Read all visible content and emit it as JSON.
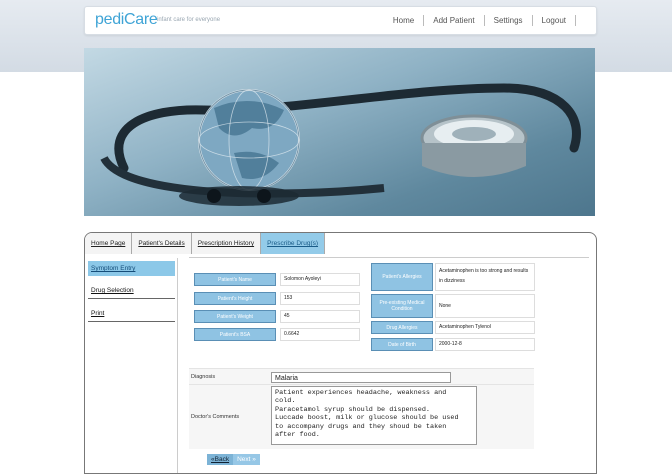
{
  "app": {
    "name": "pediCare",
    "tagline": "infant care for everyone"
  },
  "nav": [
    "Home",
    "Add Patient",
    "Settings",
    "Logout"
  ],
  "tabs": [
    "Home Page",
    "Patient's Details",
    "Prescription History",
    "Prescribe Drug(s)"
  ],
  "sidebar": [
    "Symptom Entry",
    "Drug Selection",
    "Print"
  ],
  "patient": {
    "name_label": "Patient's Name",
    "name": "Solomon Ayoleyi",
    "height_label": "Patient's Height",
    "height": "153",
    "weight_label": "Patient's Weight",
    "weight": "45",
    "bsa_label": "Patient's BSA",
    "bsa": "0.6642",
    "allergies_label": "Patient's Allergies",
    "allergies": "Acetaminophen is too strong and results in dizziness",
    "preexisting_label": "Pre-existing Medical Condition",
    "preexisting": "None",
    "drug_allergies_label": "Drug Allergies",
    "drug_allergies": "Acetaminophen Tylenol",
    "dob_label": "Date of Birth",
    "dob": "2000-12-8"
  },
  "form": {
    "diagnosis_label": "Diagnosis",
    "diagnosis": "Malaria",
    "comments_label": "Doctor's Comments",
    "comments": "Patient experiences headache, weakness and\ncold.\nParacetamol syrup should be dispensed.\nLuccade boost, milk or glucose should be used\nto accompany drugs and they shoud be taken\nafter food."
  },
  "buttons": {
    "back": "«Back",
    "next": "Next »"
  }
}
